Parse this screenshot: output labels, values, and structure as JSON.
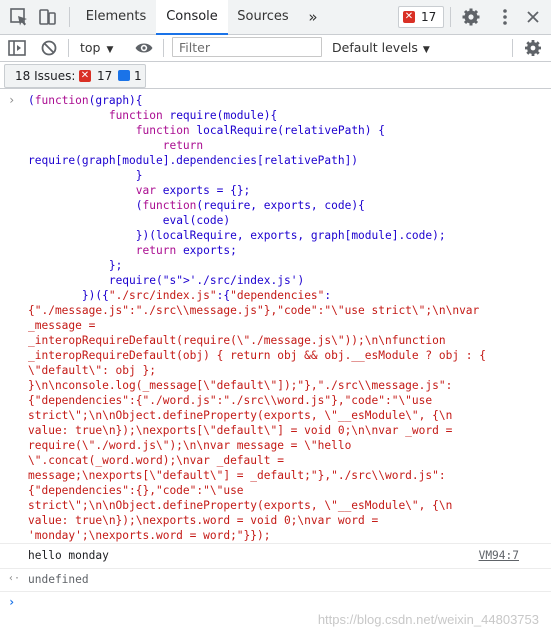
{
  "tabs": {
    "elements": "Elements",
    "console": "Console",
    "sources": "Sources",
    "more": "»",
    "error_count": "17"
  },
  "toolbar": {
    "context": "top",
    "filter_placeholder": "Filter",
    "levels": "Default levels"
  },
  "issues": {
    "label": "18 Issues:",
    "errors": "17",
    "info": "1"
  },
  "console": {
    "input_prompt": "›",
    "log_text": "hello monday",
    "log_source": "VM94:7",
    "result_prompt": "‹·",
    "result_text": "undefined",
    "new_prompt": "›"
  },
  "code_lines": [
    "(function(graph){",
    "            function require(module){",
    "                function localRequire(relativePath) {",
    "                    return",
    "require(graph[module].dependencies[relativePath])",
    "                }",
    "                var exports = {};",
    "                (function(require, exports, code){",
    "                    eval(code)",
    "                })(localRequire, exports, graph[module].code);",
    "                return exports;",
    "            };",
    "            require('./src/index.js')",
    "        })({\"./src/index.js\":{\"dependencies\":",
    "{\"./message.js\":\"./src\\\\message.js\"},\"code\":\"\\\"use strict\\\";\\n\\nvar",
    "_message =",
    "_interopRequireDefault(require(\\\"./message.js\\\"));\\n\\nfunction",
    "_interopRequireDefault(obj) { return obj && obj.__esModule ? obj : {",
    "\\\"default\\\": obj };",
    "}\\n\\nconsole.log(_message[\\\"default\\\"]);\"},\"./src\\\\message.js\":",
    "{\"dependencies\":{\"./word.js\":\"./src\\\\word.js\"},\"code\":\"\\\"use",
    "strict\\\";\\n\\nObject.defineProperty(exports, \\\"__esModule\\\", {\\n",
    "value: true\\n});\\nexports[\\\"default\\\"] = void 0;\\n\\nvar _word =",
    "require(\\\"./word.js\\\");\\n\\nvar message = \\\"hello",
    "\\\".concat(_word.word);\\nvar _default =",
    "message;\\nexports[\\\"default\\\"] = _default;\"},\"./src\\\\word.js\":",
    "{\"dependencies\":{},\"code\":\"\\\"use",
    "strict\\\";\\n\\nObject.defineProperty(exports, \\\"__esModule\\\", {\\n",
    "value: true\\n});\\nexports.word = void 0;\\nvar word =",
    "'monday';\\nexports.word = word;\"}});"
  ],
  "watermark": "https://blog.csdn.net/weixin_44803753",
  "colors": {
    "keyword": "#aa0d91",
    "string": "#c41a16",
    "accent": "#1a73e8",
    "error": "#d93025"
  }
}
